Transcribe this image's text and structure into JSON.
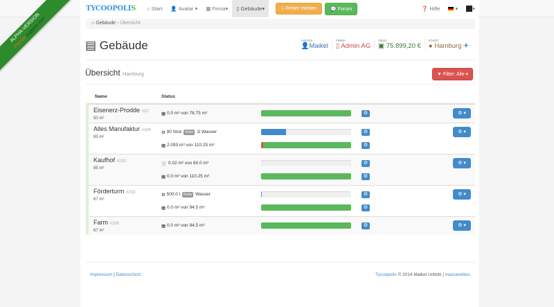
{
  "banner": {
    "line1": "ALPHA-VERSION",
    "please": "Please",
    "support": "support me!"
  },
  "nav": {
    "logo_a": "TYCOOPOLI",
    "logo_b": "S",
    "items": [
      {
        "label": "Start",
        "icon": "home-icon"
      },
      {
        "label": "Avatar ▾",
        "icon": "user-icon"
      },
      {
        "label": "Firma▾",
        "icon": "briefcase-icon"
      },
      {
        "label": "Gebäude▾",
        "icon": "building-icon",
        "active": true
      }
    ],
    "bug": "Fehler melden",
    "forum": "Forum",
    "help": "Hilfe"
  },
  "breadcrumb": {
    "home": "Gebäude",
    "current": "Übersicht"
  },
  "title": "Gebäude",
  "stats": [
    {
      "label": "Avatar",
      "value": "Maikel",
      "color": "#3a6ea5"
    },
    {
      "label": "Firma",
      "value": "Admin AG",
      "color": "#c9484a"
    },
    {
      "label": "Geld",
      "value": "75.899,20 €",
      "color": "#3c763d"
    },
    {
      "label": "Stadt",
      "value": "Hamburg",
      "color": "#8a6d3b"
    }
  ],
  "section": {
    "title": "Übersicht",
    "subtitle": "Hamburg",
    "filter": "Filter: Alle ▾"
  },
  "table": {
    "headers": [
      "Name",
      "Status"
    ],
    "rows": [
      {
        "name": "Eisenerz-Prodde",
        "id": "#10",
        "size": "50 m²",
        "lines": [
          {
            "icon": "storage-icon",
            "text": "0.0 m³ von 78.75 m³",
            "bar": [
              {
                "pct": 100,
                "color": "#5cb85c"
              }
            ]
          }
        ]
      },
      {
        "name": "Alles Manufaktur",
        "id": "#184",
        "size": "85 m²",
        "lines": [
          {
            "icon": "gear-icon",
            "text": "90 Stck",
            "badge": "Ruhe",
            "text2": "1l Wasser",
            "bar": [
              {
                "pct": 28,
                "color": "#428bca"
              }
            ]
          },
          {
            "icon": "storage-icon",
            "text": "2.093 m³ von 110.25 m³",
            "bar": [
              {
                "pct": 2,
                "color": "#d9534f"
              },
              {
                "pct": 98,
                "color": "#5cb85c"
              }
            ]
          }
        ]
      },
      {
        "name": "Kaufhof",
        "id": "#230",
        "size": "85 m²",
        "lines": [
          {
            "icon": "cart-icon",
            "text": "0.02 m³ von 60.0 m³",
            "bar": []
          },
          {
            "icon": "storage-icon",
            "text": "0.0 m³ von 110.25 m³",
            "bar": [
              {
                "pct": 100,
                "color": "#5cb85c"
              }
            ]
          }
        ]
      },
      {
        "name": "Förderturm",
        "id": "#233",
        "size": "67 m²",
        "lines": [
          {
            "icon": "gear-icon",
            "text": "500.0 l",
            "badge": "Ruhe",
            "text2": "Wasser",
            "bar": [
              {
                "pct": 1,
                "color": "#428bca"
              }
            ]
          },
          {
            "icon": "storage-icon",
            "text": "0.0 m³ von 94.5 m³",
            "bar": [
              {
                "pct": 100,
                "color": "#5cb85c"
              }
            ]
          }
        ]
      },
      {
        "name": "Farm",
        "id": "#338",
        "size": "67 m²",
        "lines": [
          {
            "icon": "storage-icon",
            "text": "0.0 m³ von 94.5 m³",
            "bar": [
              {
                "pct": 100,
                "color": "#5cb85c"
              }
            ]
          }
        ]
      }
    ]
  },
  "footer": {
    "impressum": "Impressum",
    "datenschutz": "Datenschutz",
    "brand": "Tycoopolis",
    "copy": "© 2014 Maikel Urlitzki",
    "credit": "manuwebtur"
  }
}
